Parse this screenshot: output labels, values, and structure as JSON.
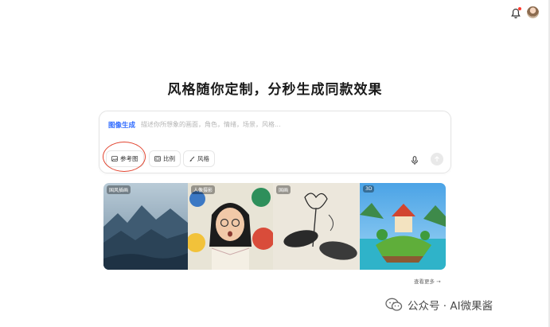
{
  "topbar": {
    "bell_icon": "bell-icon",
    "avatar_icon": "user-avatar"
  },
  "hero": {
    "title": "风格随你定制，分秒生成同款效果"
  },
  "composer": {
    "mode_label": "图像生成",
    "prompt_placeholder": "描述你所想象的画面，角色，情绪，场景，风格...",
    "chips": [
      {
        "label": "参考图",
        "icon": "image-icon"
      },
      {
        "label": "比例",
        "icon": "aspect-ratio-icon"
      },
      {
        "label": "风格",
        "icon": "brush-icon"
      }
    ],
    "mic_icon": "microphone-icon",
    "send_icon": "arrow-up-icon"
  },
  "gallery": [
    {
      "tag": "国风插画"
    },
    {
      "tag": "人像摄影"
    },
    {
      "tag": "国画"
    },
    {
      "tag": "3D"
    }
  ],
  "view_more": "查看更多 →",
  "watermark": {
    "text": "公众号 · AI微果酱",
    "icon": "wechat-icon"
  },
  "colors": {
    "accent": "#2f6bff",
    "highlight_ring": "#e2442f"
  }
}
